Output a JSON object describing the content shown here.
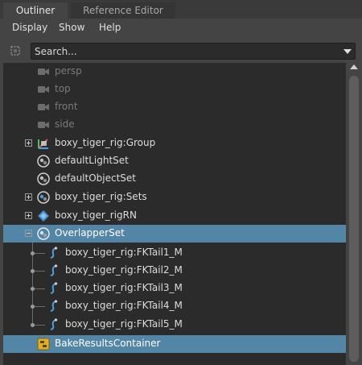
{
  "tabs": [
    {
      "label": "Outliner",
      "active": true
    },
    {
      "label": "Reference Editor",
      "active": false
    }
  ],
  "menu": [
    "Display",
    "Show",
    "Help"
  ],
  "search": {
    "placeholder": "Search..."
  },
  "tree": [
    {
      "label": "persp",
      "icon": "camera-icon",
      "dimmed": true
    },
    {
      "label": "top",
      "icon": "camera-icon",
      "dimmed": true
    },
    {
      "label": "front",
      "icon": "camera-icon",
      "dimmed": true
    },
    {
      "label": "side",
      "icon": "camera-icon",
      "dimmed": true
    },
    {
      "label": "boxy_tiger_rig:Group",
      "icon": "group-node-icon",
      "expander": "plus"
    },
    {
      "label": "defaultLightSet",
      "icon": "set-icon"
    },
    {
      "label": "defaultObjectSet",
      "icon": "set-icon"
    },
    {
      "label": "boxy_tiger_rig:Sets",
      "icon": "set-icon",
      "expander": "plus"
    },
    {
      "label": "boxy_tiger_rigRN",
      "icon": "reference-node-icon",
      "expander": "plus"
    },
    {
      "label": "OverlapperSet",
      "icon": "set-icon",
      "expander": "minus",
      "selected": true
    },
    {
      "label": "boxy_tiger_rig:FKTail1_M",
      "icon": "curve-icon",
      "child": true
    },
    {
      "label": "boxy_tiger_rig:FKTail2_M",
      "icon": "curve-icon",
      "child": true
    },
    {
      "label": "boxy_tiger_rig:FKTail3_M",
      "icon": "curve-icon",
      "child": true
    },
    {
      "label": "boxy_tiger_rig:FKTail4_M",
      "icon": "curve-icon",
      "child": true
    },
    {
      "label": "boxy_tiger_rig:FKTail5_M",
      "icon": "curve-icon",
      "child": true
    },
    {
      "label": "BakeResultsContainer",
      "icon": "container-icon",
      "selected": true
    }
  ],
  "colors": {
    "selection": "#5285a6",
    "panel": "#444444",
    "tree_background": "#2b2b2b"
  }
}
